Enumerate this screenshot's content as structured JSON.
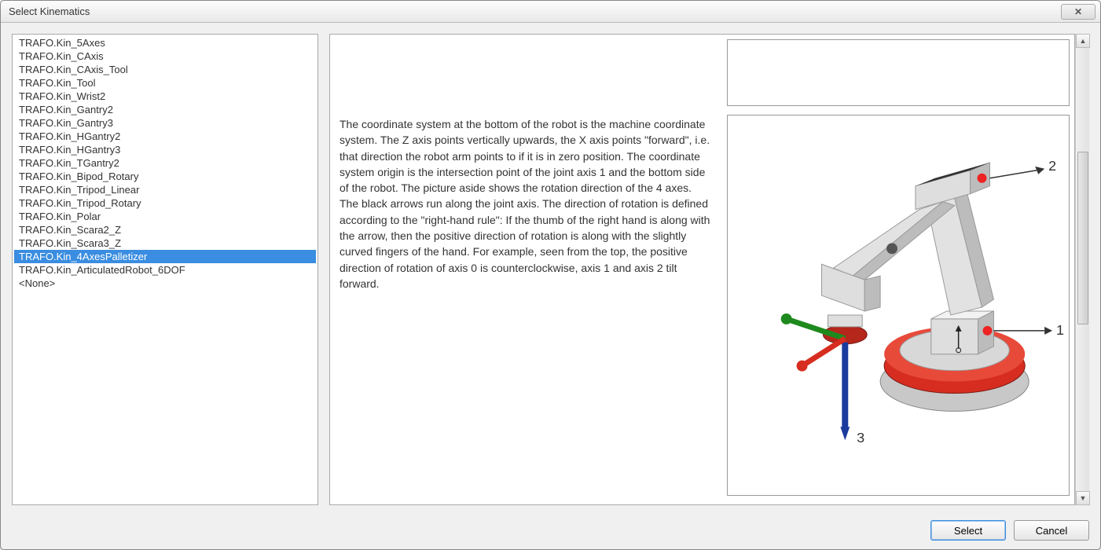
{
  "window": {
    "title": "Select Kinematics"
  },
  "list": {
    "items": [
      "TRAFO.Kin_5Axes",
      "TRAFO.Kin_CAxis",
      "TRAFO.Kin_CAxis_Tool",
      "TRAFO.Kin_Tool",
      "TRAFO.Kin_Wrist2",
      "TRAFO.Kin_Gantry2",
      "TRAFO.Kin_Gantry3",
      "TRAFO.Kin_HGantry2",
      "TRAFO.Kin_HGantry3",
      "TRAFO.Kin_TGantry2",
      "TRAFO.Kin_Bipod_Rotary",
      "TRAFO.Kin_Tripod_Linear",
      "TRAFO.Kin_Tripod_Rotary",
      "TRAFO.Kin_Polar",
      "TRAFO.Kin_Scara2_Z",
      "TRAFO.Kin_Scara3_Z",
      "TRAFO.Kin_4AxesPalletizer",
      "TRAFO.Kin_ArticulatedRobot_6DOF",
      "<None>"
    ],
    "selected_index": 16
  },
  "description": "The coordinate system at the bottom of the robot is the machine coordinate system. The Z axis points vertically upwards, the X axis points \"forward\", i.e. that direction the robot arm points to if it is in zero position. The coordinate system origin is the intersection point of the joint axis 1 and the bottom side of the robot. The picture aside shows the rotation direction of the 4 axes. The black arrows run along the joint axis. The direction of rotation is defined according to the \"right-hand rule\": If the thumb of the right hand is along with the arrow, then the positive direction of rotation is along with the slightly curved fingers of the hand. For example, seen from the top, the positive direction of rotation of axis 0 is counterclockwise, axis 1 and axis 2 tilt forward.",
  "buttons": {
    "select": "Select",
    "cancel": "Cancel"
  },
  "image_labels": {
    "axis1": "1",
    "axis2": "2",
    "axis3": "3"
  }
}
